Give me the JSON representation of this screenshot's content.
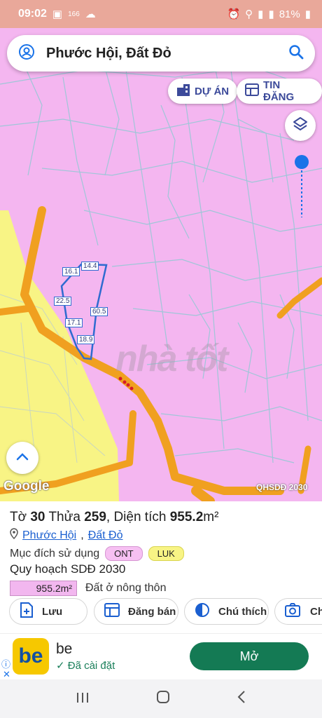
{
  "status_bar": {
    "time": "09:02",
    "notif_count": "166",
    "battery": "81%"
  },
  "search": {
    "place": "Phước Hội, Đất Đỏ"
  },
  "chips": {
    "du_an": "DỰ ÁN",
    "tin_dang": "TIN ĐĂNG"
  },
  "map": {
    "brand": "Google",
    "layer_label": "QHSDĐ 2030",
    "watermark": "nhà tốt",
    "parcel_labels": [
      "14.4",
      "16.1",
      "22.5",
      "60.5",
      "17.1",
      "18.9"
    ]
  },
  "parcel": {
    "to_label": "Tờ",
    "to_value": "30",
    "thua_label": "Thửa",
    "thua_value": "259",
    "dien_tich_label": "Diện tích",
    "dien_tich_value": "955.2",
    "dien_tich_unit": "m²",
    "ward": "Phước Hội",
    "comma": ",",
    "district": "Đất Đỏ",
    "purpose_label": "Mục đích sử dụng",
    "tags": [
      "ONT",
      "LUK"
    ],
    "plan_label": "Quy hoạch SDĐ 2030",
    "plan_area": "955.2m²",
    "plan_type": "Đất ở nông thôn"
  },
  "actions": {
    "luu": "Lưu",
    "dang_ban": "Đăng bán",
    "chu_thich": "Chú thích",
    "chup": "Chụ"
  },
  "ad": {
    "logo": "be",
    "title": "be",
    "subtitle": "Đã cài đặt",
    "button": "Mở",
    "info": "ⓘ",
    "close": "✕"
  },
  "colors": {
    "land_pink": "#f4b6f0",
    "land_yellow": "#f8f485",
    "road_orange": "#f0a020",
    "accent_green": "#147a54",
    "accent_blue": "#1a73e8"
  }
}
